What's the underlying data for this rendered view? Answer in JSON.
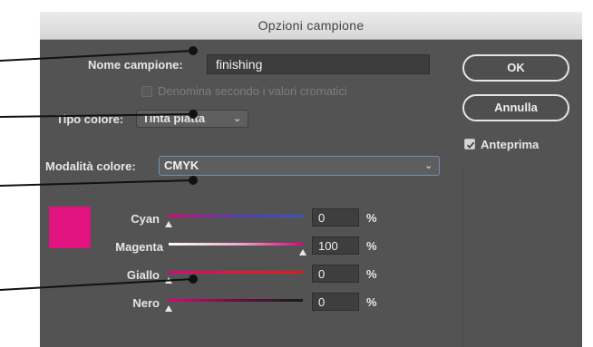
{
  "dialog": {
    "title": "Opzioni campione",
    "swatch_name_label": "Nome campione:",
    "swatch_name_value": "finishing",
    "name_by_value_label": "Denomina secondo i valori cromatici",
    "color_type_label": "Tipo colore:",
    "color_type_value": "Tinta piatta",
    "color_mode_label": "Modalità colore:",
    "color_mode_value": "CMYK",
    "ok_label": "OK",
    "cancel_label": "Annulla",
    "preview_label": "Anteprima",
    "swatch_color": "#e0137f",
    "sliders": [
      {
        "label": "Cyan",
        "value": "0",
        "unit": "%",
        "level": 0
      },
      {
        "label": "Magenta",
        "value": "100",
        "unit": "%",
        "level": 100
      },
      {
        "label": "Giallo",
        "value": "0",
        "unit": "%",
        "level": 0
      },
      {
        "label": "Nero",
        "value": "0",
        "unit": "%",
        "level": 0
      }
    ]
  },
  "icons": {
    "preview_check": "checkmark-icon",
    "dropdown": "chevron-down-icon"
  }
}
